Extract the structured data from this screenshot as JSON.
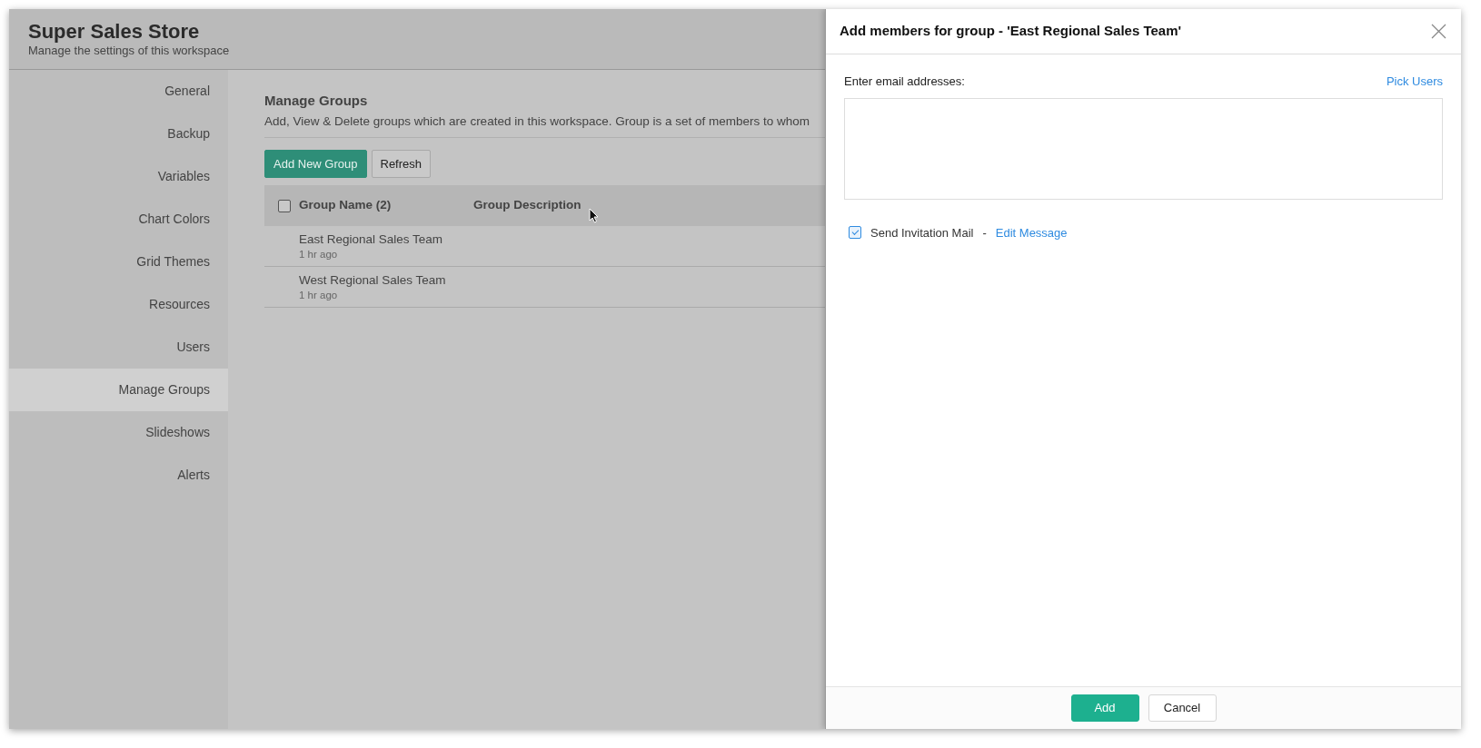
{
  "header": {
    "title": "Super Sales Store",
    "subtitle": "Manage the settings of this workspace"
  },
  "sidebar": {
    "items": [
      {
        "label": "General",
        "selected": false
      },
      {
        "label": "Backup",
        "selected": false
      },
      {
        "label": "Variables",
        "selected": false
      },
      {
        "label": "Chart Colors",
        "selected": false
      },
      {
        "label": "Grid Themes",
        "selected": false
      },
      {
        "label": "Resources",
        "selected": false
      },
      {
        "label": "Users",
        "selected": false
      },
      {
        "label": "Manage Groups",
        "selected": true
      },
      {
        "label": "Slideshows",
        "selected": false
      },
      {
        "label": "Alerts",
        "selected": false
      }
    ]
  },
  "content": {
    "title": "Manage Groups",
    "description": "Add, View & Delete groups which are created in this workspace. Group is a set of members to whom",
    "buttons": [
      {
        "label": "Add New Group",
        "kind": "primary"
      },
      {
        "label": "Refresh",
        "kind": "secondary"
      }
    ],
    "table": {
      "select_all_checked": false,
      "columns": [
        "Group Name (2)",
        "Group Description"
      ],
      "rows": [
        {
          "name": "East Regional Sales Team",
          "time": "1 hr ago"
        },
        {
          "name": "West Regional Sales Team",
          "time": "1 hr ago"
        }
      ]
    }
  },
  "dialog": {
    "title": "Add members for group - 'East Regional Sales Team'",
    "email_label": "Enter email addresses:",
    "pick_users": "Pick Users",
    "send_invitation": {
      "label": "Send Invitation Mail",
      "checked": true,
      "separator": "-",
      "link": "Edit Message"
    },
    "buttons": [
      {
        "label": "Add",
        "kind": "primary"
      },
      {
        "label": "Cancel",
        "kind": "secondary"
      }
    ]
  }
}
